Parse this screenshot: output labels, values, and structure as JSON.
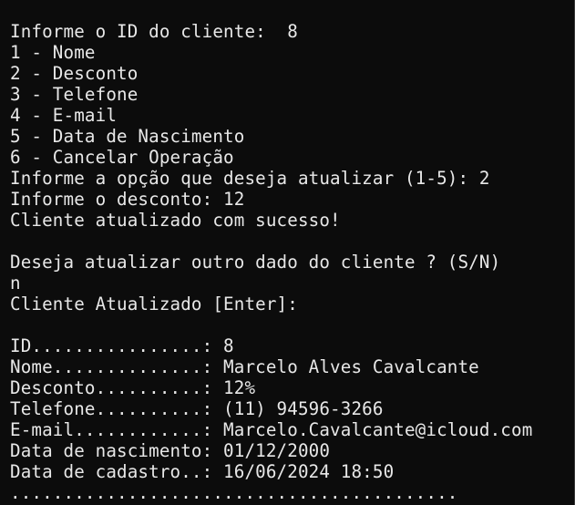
{
  "terminal": {
    "lines": [
      "Informe o ID do cliente:  8",
      "1 - Nome",
      "2 - Desconto",
      "3 - Telefone",
      "4 - E-mail",
      "5 - Data de Nascimento",
      "6 - Cancelar Operação",
      "Informe a opção que deseja atualizar (1-5): 2",
      "Informe o desconto: 12",
      "Cliente atualizado com sucesso!",
      "",
      "Deseja atualizar outro dado do cliente ? (S/N)",
      "n",
      "Cliente Atualizado [Enter]:",
      "",
      "ID................: 8",
      "Nome..............: Marcelo Alves Cavalcante",
      "Desconto..........: 12%",
      "Telefone..........: (11) 94596-3266",
      "E-mail............: Marcelo.Cavalcante@icloud.com",
      "Data de nascimento: 01/12/2000",
      "Data de cadastro..: 16/06/2024 18:50",
      ".........................................."
    ]
  },
  "colors": {
    "background": "#0c0c0c",
    "text": "#e8e8e8"
  }
}
